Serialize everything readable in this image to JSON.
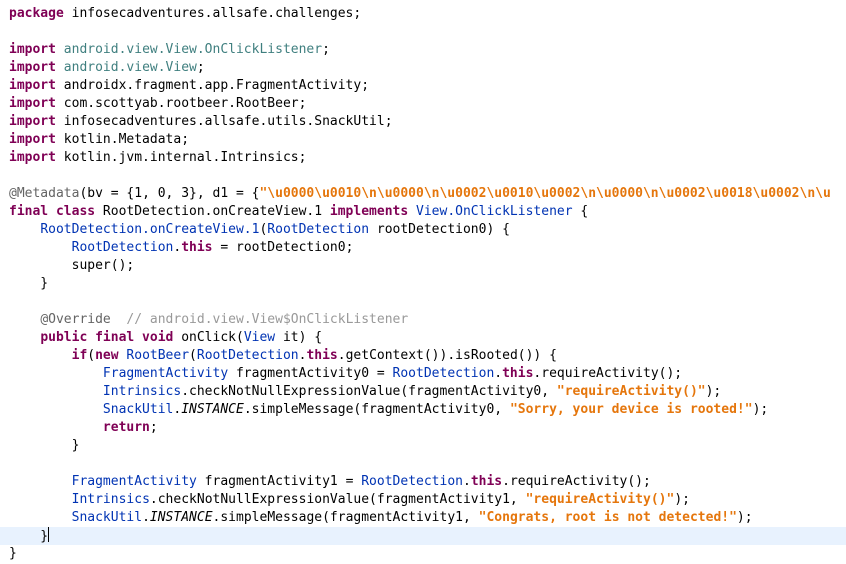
{
  "lines": [
    {
      "s": [
        {
          "c": "kw",
          "t": "package"
        },
        {
          "c": "",
          "t": " infosecadventures.allsafe.challenges;"
        }
      ]
    },
    {
      "s": []
    },
    {
      "s": [
        {
          "c": "kw",
          "t": "import"
        },
        {
          "c": "",
          "t": " "
        },
        {
          "c": "pk",
          "t": "android.view.View.OnClickListener"
        },
        {
          "c": "",
          "t": ";"
        }
      ]
    },
    {
      "s": [
        {
          "c": "kw",
          "t": "import"
        },
        {
          "c": "",
          "t": " "
        },
        {
          "c": "pk",
          "t": "android.view.View"
        },
        {
          "c": "",
          "t": ";"
        }
      ]
    },
    {
      "s": [
        {
          "c": "kw",
          "t": "import"
        },
        {
          "c": "",
          "t": " androidx.fragment.app.FragmentActivity;"
        }
      ]
    },
    {
      "s": [
        {
          "c": "kw",
          "t": "import"
        },
        {
          "c": "",
          "t": " com.scottyab.rootbeer.RootBeer;"
        }
      ]
    },
    {
      "s": [
        {
          "c": "kw",
          "t": "import"
        },
        {
          "c": "",
          "t": " infosecadventures.allsafe.utils.SnackUtil;"
        }
      ]
    },
    {
      "s": [
        {
          "c": "kw",
          "t": "import"
        },
        {
          "c": "",
          "t": " kotlin.Metadata;"
        }
      ]
    },
    {
      "s": [
        {
          "c": "kw",
          "t": "import"
        },
        {
          "c": "",
          "t": " kotlin.jvm.internal.Intrinsics;"
        }
      ]
    },
    {
      "s": []
    },
    {
      "s": [
        {
          "c": "an",
          "t": "@Metadata"
        },
        {
          "c": "",
          "t": "(bv = {1, 0, 3}, d1 = {"
        },
        {
          "c": "st",
          "t": "\"\\u0000\\u0010\\n\\u0000\\n\\u0002\\u0010\\u0002\\n\\u0000\\n\\u0002\\u0018\\u0002\\n\\u"
        }
      ]
    },
    {
      "s": [
        {
          "c": "kw",
          "t": "final class"
        },
        {
          "c": "",
          "t": " RootDetection.onCreateView.1 "
        },
        {
          "c": "kw",
          "t": "implements"
        },
        {
          "c": "",
          "t": " "
        },
        {
          "c": "ty",
          "t": "View.OnClickListener"
        },
        {
          "c": "",
          "t": " {"
        }
      ]
    },
    {
      "s": [
        {
          "c": "",
          "t": "    "
        },
        {
          "c": "ty",
          "t": "RootDetection.onCreateView.1"
        },
        {
          "c": "",
          "t": "("
        },
        {
          "c": "ty",
          "t": "RootDetection"
        },
        {
          "c": "",
          "t": " rootDetection0) {"
        }
      ]
    },
    {
      "s": [
        {
          "c": "",
          "t": "        "
        },
        {
          "c": "ty",
          "t": "RootDetection"
        },
        {
          "c": "",
          "t": "."
        },
        {
          "c": "kw",
          "t": "this"
        },
        {
          "c": "",
          "t": " = rootDetection0;"
        }
      ]
    },
    {
      "s": [
        {
          "c": "",
          "t": "        super();"
        }
      ]
    },
    {
      "s": [
        {
          "c": "",
          "t": "    }"
        }
      ]
    },
    {
      "s": []
    },
    {
      "s": [
        {
          "c": "",
          "t": "    "
        },
        {
          "c": "an",
          "t": "@Override"
        },
        {
          "c": "",
          "t": "  "
        },
        {
          "c": "cm",
          "t": "// android.view.View$OnClickListener"
        }
      ]
    },
    {
      "s": [
        {
          "c": "",
          "t": "    "
        },
        {
          "c": "kw",
          "t": "public final void"
        },
        {
          "c": "",
          "t": " onClick("
        },
        {
          "c": "ty",
          "t": "View"
        },
        {
          "c": "",
          "t": " it) {"
        }
      ]
    },
    {
      "s": [
        {
          "c": "",
          "t": "        "
        },
        {
          "c": "kw",
          "t": "if"
        },
        {
          "c": "",
          "t": "("
        },
        {
          "c": "kw",
          "t": "new"
        },
        {
          "c": "",
          "t": " "
        },
        {
          "c": "ty",
          "t": "RootBeer"
        },
        {
          "c": "",
          "t": "("
        },
        {
          "c": "ty",
          "t": "RootDetection"
        },
        {
          "c": "",
          "t": "."
        },
        {
          "c": "kw",
          "t": "this"
        },
        {
          "c": "",
          "t": ".getContext()).isRooted()) {"
        }
      ]
    },
    {
      "s": [
        {
          "c": "",
          "t": "            "
        },
        {
          "c": "ty",
          "t": "FragmentActivity"
        },
        {
          "c": "",
          "t": " fragmentActivity0 = "
        },
        {
          "c": "ty",
          "t": "RootDetection"
        },
        {
          "c": "",
          "t": "."
        },
        {
          "c": "kw",
          "t": "this"
        },
        {
          "c": "",
          "t": ".requireActivity();"
        }
      ]
    },
    {
      "s": [
        {
          "c": "",
          "t": "            "
        },
        {
          "c": "ty",
          "t": "Intrinsics"
        },
        {
          "c": "",
          "t": ".checkNotNullExpressionValue(fragmentActivity0, "
        },
        {
          "c": "st",
          "t": "\"requireActivity()\""
        },
        {
          "c": "",
          "t": ");"
        }
      ]
    },
    {
      "s": [
        {
          "c": "",
          "t": "            "
        },
        {
          "c": "ty",
          "t": "SnackUtil"
        },
        {
          "c": "",
          "t": "."
        },
        {
          "c": "it",
          "t": "INSTANCE"
        },
        {
          "c": "",
          "t": ".simpleMessage(fragmentActivity0, "
        },
        {
          "c": "st",
          "t": "\"Sorry, your device is rooted!\""
        },
        {
          "c": "",
          "t": ");"
        }
      ]
    },
    {
      "s": [
        {
          "c": "",
          "t": "            "
        },
        {
          "c": "kw",
          "t": "return"
        },
        {
          "c": "",
          "t": ";"
        }
      ]
    },
    {
      "s": [
        {
          "c": "",
          "t": "        }"
        }
      ]
    },
    {
      "s": []
    },
    {
      "s": [
        {
          "c": "",
          "t": "        "
        },
        {
          "c": "ty",
          "t": "FragmentActivity"
        },
        {
          "c": "",
          "t": " fragmentActivity1 = "
        },
        {
          "c": "ty",
          "t": "RootDetection"
        },
        {
          "c": "",
          "t": "."
        },
        {
          "c": "kw",
          "t": "this"
        },
        {
          "c": "",
          "t": ".requireActivity();"
        }
      ]
    },
    {
      "s": [
        {
          "c": "",
          "t": "        "
        },
        {
          "c": "ty",
          "t": "Intrinsics"
        },
        {
          "c": "",
          "t": ".checkNotNullExpressionValue(fragmentActivity1, "
        },
        {
          "c": "st",
          "t": "\"requireActivity()\""
        },
        {
          "c": "",
          "t": ");"
        }
      ]
    },
    {
      "s": [
        {
          "c": "",
          "t": "        "
        },
        {
          "c": "ty",
          "t": "SnackUtil"
        },
        {
          "c": "",
          "t": "."
        },
        {
          "c": "it",
          "t": "INSTANCE"
        },
        {
          "c": "",
          "t": ".simpleMessage(fragmentActivity1, "
        },
        {
          "c": "st",
          "t": "\"Congrats, root is not detected!\""
        },
        {
          "c": "",
          "t": ");"
        }
      ]
    },
    {
      "s": [
        {
          "c": "",
          "t": "    }"
        }
      ],
      "current": true
    },
    {
      "s": [
        {
          "c": "",
          "t": "}"
        }
      ]
    }
  ],
  "colors": {
    "keyword": "#7f0055",
    "type": "#0033b3",
    "package": "#3f7f7f",
    "string": "#e5760c",
    "annotation": "#646464",
    "comment": "#999999",
    "current_line": "#e8f2fe"
  }
}
